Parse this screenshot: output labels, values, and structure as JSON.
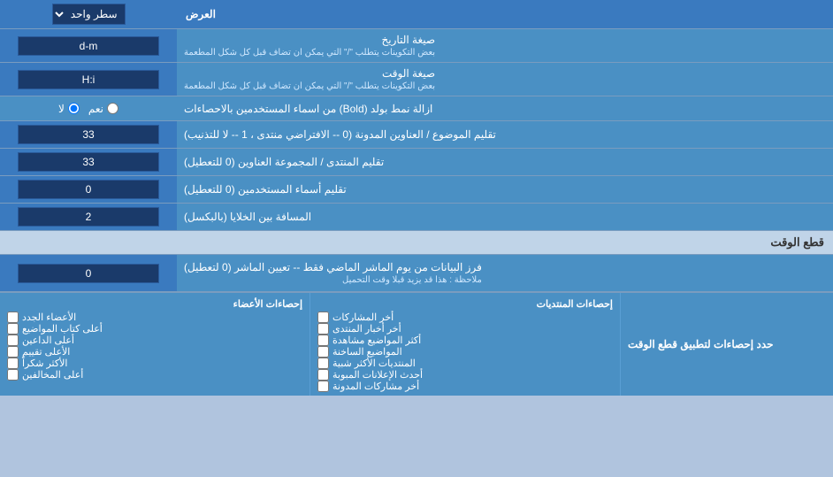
{
  "header": {
    "title": "العرض",
    "dropdown_label": "سطر واحد"
  },
  "rows": [
    {
      "id": "date_format",
      "label": "صيغة التاريخ",
      "sub_label": "بعض التكوينات يتطلب \"/\" التي يمكن ان تضاف قبل كل شكل المطعمة",
      "input_value": "d-m",
      "type": "input"
    },
    {
      "id": "time_format",
      "label": "صيغة الوقت",
      "sub_label": "بعض التكوينات يتطلب \"/\" التي يمكن ان تضاف قبل كل شكل المطعمة",
      "input_value": "H:i",
      "type": "input"
    },
    {
      "id": "bold_remove",
      "label": "ازالة نمط بولد (Bold) من اسماء المستخدمين بالاحصاءات",
      "radio_yes": "نعم",
      "radio_no": "لا",
      "selected": "no",
      "type": "radio"
    },
    {
      "id": "titles_order",
      "label": "تقليم الموضوع / العناوين المدونة (0 -- الافتراضي منتدى ، 1 -- لا للتذنيب)",
      "input_value": "33",
      "type": "input"
    },
    {
      "id": "forum_titles",
      "label": "تقليم المنتدى / المجموعة العناوين (0 للتعطيل)",
      "input_value": "33",
      "type": "input"
    },
    {
      "id": "usernames_trim",
      "label": "تقليم أسماء المستخدمين (0 للتعطيل)",
      "input_value": "0",
      "type": "input"
    },
    {
      "id": "cell_spacing",
      "label": "المسافة بين الخلايا (بالبكسل)",
      "input_value": "2",
      "type": "input"
    }
  ],
  "section_cutoff": {
    "title": "قطع الوقت",
    "row": {
      "label": "فرز البيانات من يوم الماشر الماضي فقط -- تعيين الماشر (0 لتعطيل)",
      "sub_label": "ملاحظة : هذا قد يزيد قبلا وقت التحميل",
      "input_value": "0"
    },
    "limit_label": "حدد إحصاءات لتطبيق قطع الوقت"
  },
  "checkboxes": {
    "col1_header": "إحصاءات الأعضاء",
    "col2_header": "إحصاءات المنتديات",
    "col1_items": [
      {
        "label": "الأعضاء الجدد",
        "checked": false
      },
      {
        "label": "أعلى كتاب المواضيع",
        "checked": false
      },
      {
        "label": "أعلى الداعين",
        "checked": false
      },
      {
        "label": "الأعلى تقييم",
        "checked": false
      },
      {
        "label": "الأكثر شكراً",
        "checked": false
      },
      {
        "label": "أعلى المخالفين",
        "checked": false
      }
    ],
    "col2_items": [
      {
        "label": "أخر المشاركات",
        "checked": false
      },
      {
        "label": "أخر أخبار المنتدى",
        "checked": false
      },
      {
        "label": "أكثر المواضيع مشاهدة",
        "checked": false
      },
      {
        "label": "المواضيع الساخنة",
        "checked": false
      },
      {
        "label": "المنتديات الأكثر شبية",
        "checked": false
      },
      {
        "label": "أحدث الإعلانات المبوبة",
        "checked": false
      },
      {
        "label": "أخر مشاركات المدونة",
        "checked": false
      }
    ]
  }
}
